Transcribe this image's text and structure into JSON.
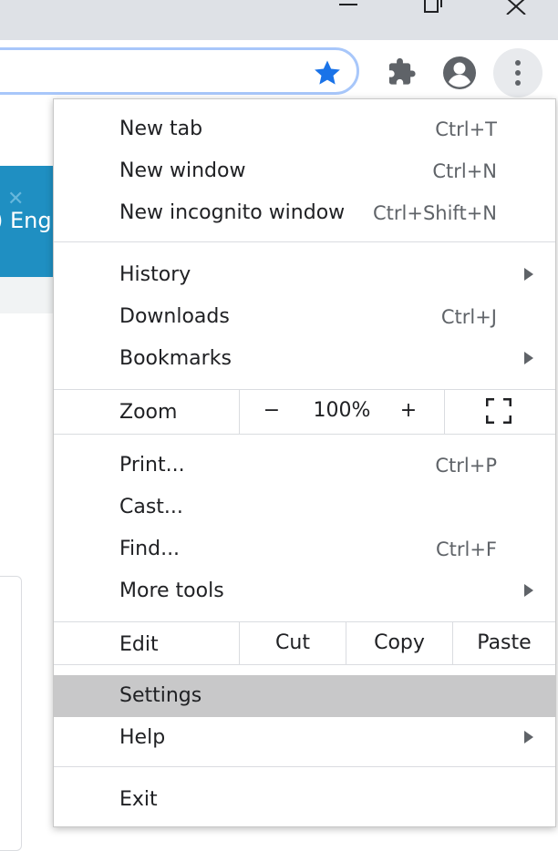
{
  "menu": {
    "new_tab": {
      "label": "New tab",
      "shortcut": "Ctrl+T"
    },
    "new_window": {
      "label": "New window",
      "shortcut": "Ctrl+N"
    },
    "new_incognito": {
      "label": "New incognito window",
      "shortcut": "Ctrl+Shift+N"
    },
    "history": {
      "label": "History"
    },
    "downloads": {
      "label": "Downloads",
      "shortcut": "Ctrl+J"
    },
    "bookmarks": {
      "label": "Bookmarks"
    },
    "zoom": {
      "label": "Zoom",
      "minus": "−",
      "value": "100%",
      "plus": "+"
    },
    "print": {
      "label": "Print...",
      "shortcut": "Ctrl+P"
    },
    "cast": {
      "label": "Cast..."
    },
    "find": {
      "label": "Find...",
      "shortcut": "Ctrl+F"
    },
    "more_tools": {
      "label": "More tools"
    },
    "edit": {
      "label": "Edit",
      "cut": "Cut",
      "copy": "Copy",
      "paste": "Paste"
    },
    "settings": {
      "label": "Settings"
    },
    "help": {
      "label": "Help"
    },
    "exit": {
      "label": "Exit"
    }
  },
  "page": {
    "partial_text": "Eng"
  },
  "colors": {
    "star": "#1a73e8",
    "menu_highlight": "#c8c8c9",
    "banner": "#1f8fc2"
  },
  "icons": [
    "minimize-icon",
    "restore-icon",
    "close-icon",
    "bookmark-star-icon",
    "extensions-icon",
    "profile-icon",
    "kebab-menu-icon",
    "fullscreen-icon",
    "submenu-arrow-icon"
  ]
}
